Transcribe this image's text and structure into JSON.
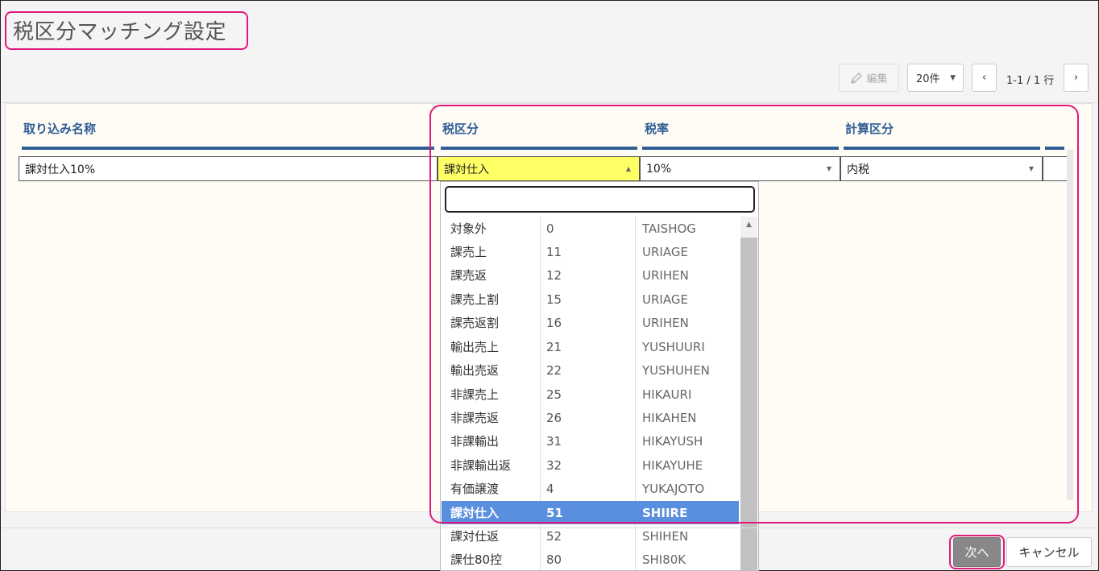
{
  "page": {
    "title": "税区分マッチング設定"
  },
  "toolbar": {
    "edit_label": "編集",
    "page_size": "20件",
    "page_info": "1-1 / 1 行"
  },
  "table": {
    "headers": [
      "取り込み名称",
      "税区分",
      "税率",
      "計算区分"
    ],
    "row": {
      "import_name": "課対仕入10%",
      "tax_class": "課対仕入",
      "tax_rate": "10%",
      "calc_class": "内税"
    }
  },
  "dropdown": {
    "search_value": "",
    "options": [
      {
        "name": "対象外",
        "code": "0",
        "key": "TAISHOG",
        "selected": false
      },
      {
        "name": "課売上",
        "code": "11",
        "key": "URIAGE",
        "selected": false
      },
      {
        "name": "課売返",
        "code": "12",
        "key": "URIHEN",
        "selected": false
      },
      {
        "name": "課売上割",
        "code": "15",
        "key": "URIAGE",
        "selected": false
      },
      {
        "name": "課売返割",
        "code": "16",
        "key": "URIHEN",
        "selected": false
      },
      {
        "name": "輸出売上",
        "code": "21",
        "key": "YUSHUURI",
        "selected": false
      },
      {
        "name": "輸出売返",
        "code": "22",
        "key": "YUSHUHEN",
        "selected": false
      },
      {
        "name": "非課売上",
        "code": "25",
        "key": "HIKAURI",
        "selected": false
      },
      {
        "name": "非課売返",
        "code": "26",
        "key": "HIKAHEN",
        "selected": false
      },
      {
        "name": "非課輸出",
        "code": "31",
        "key": "HIKAYUSH",
        "selected": false
      },
      {
        "name": "非課輸出返",
        "code": "32",
        "key": "HIKAYUHE",
        "selected": false
      },
      {
        "name": "有価譲渡",
        "code": "4",
        "key": "YUKAJOTO",
        "selected": false
      },
      {
        "name": "課対仕入",
        "code": "51",
        "key": "SHIIRE",
        "selected": true
      },
      {
        "name": "課対仕返",
        "code": "52",
        "key": "SHIHEN",
        "selected": false
      },
      {
        "name": "課仕80控",
        "code": "80",
        "key": "SHI80K",
        "selected": false
      }
    ]
  },
  "footer": {
    "next_label": "次へ",
    "cancel_label": "キャンセル"
  },
  "colors": {
    "accent_highlight": "#e0197a",
    "header_blue": "#2f5d94",
    "selected_row": "#5a8fe0",
    "active_cell": "#ffff66"
  }
}
